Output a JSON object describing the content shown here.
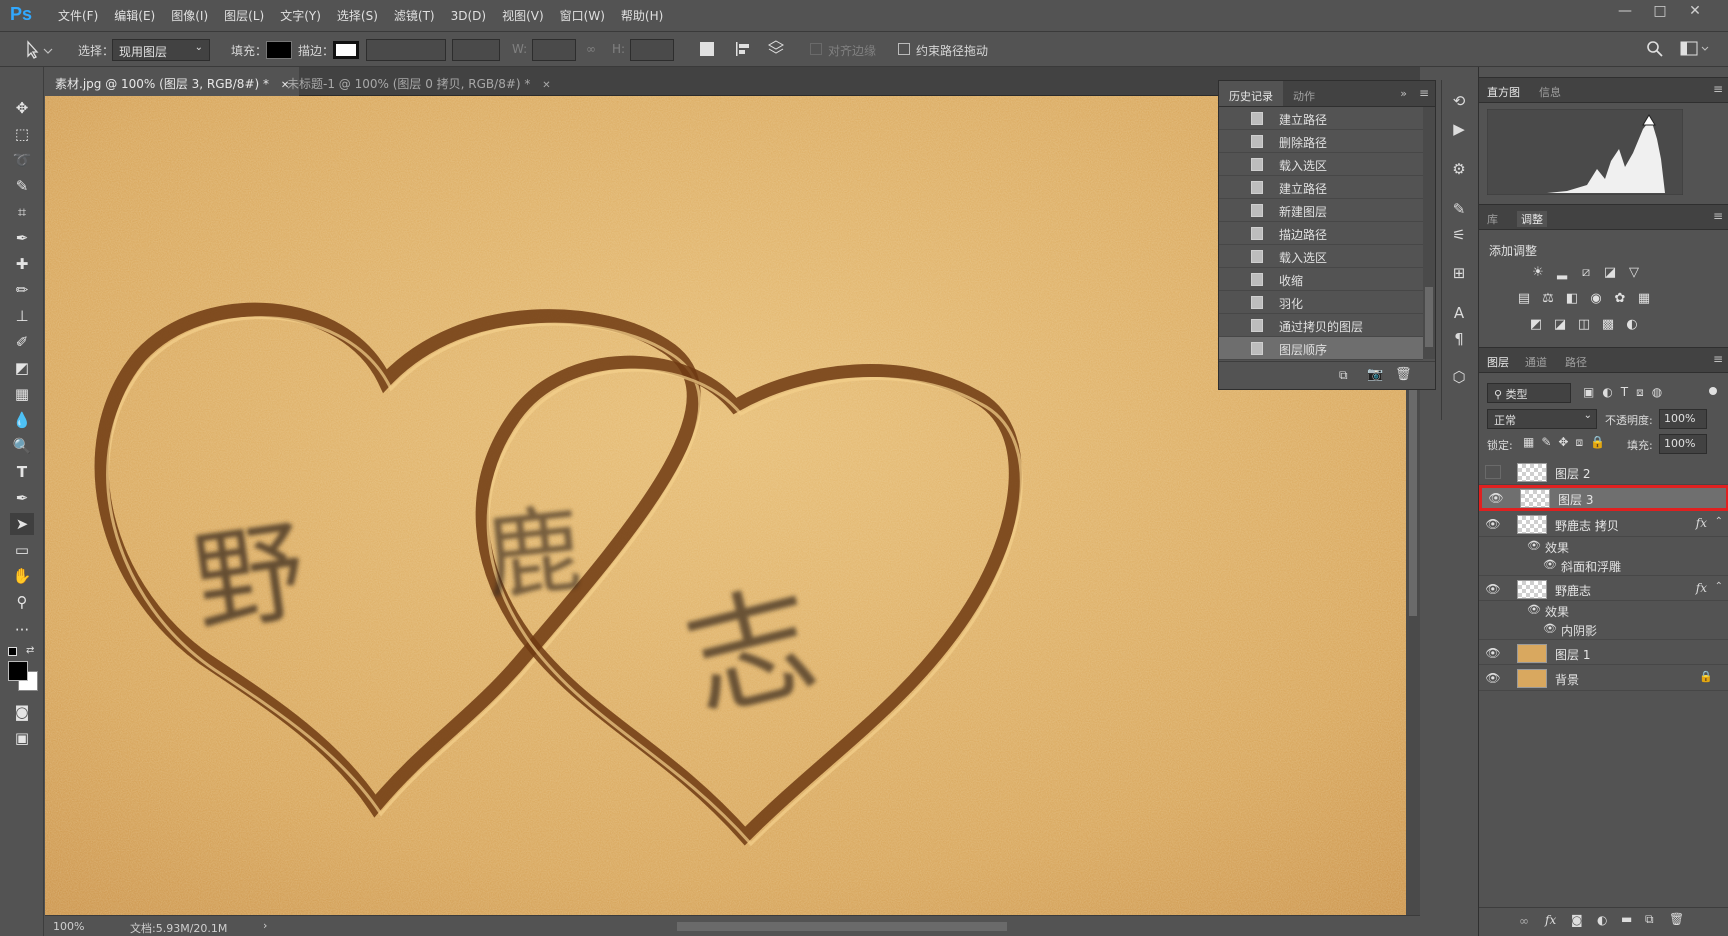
{
  "app": {
    "logo": "Ps"
  },
  "menu": [
    "文件(F)",
    "编辑(E)",
    "图像(I)",
    "图层(L)",
    "文字(Y)",
    "选择(S)",
    "滤镜(T)",
    "3D(D)",
    "视图(V)",
    "窗口(W)",
    "帮助(H)"
  ],
  "window_controls": {
    "minimize": "—",
    "maximize": "□",
    "close": "✕"
  },
  "options_bar": {
    "select_label": "选择：",
    "select_value": "现用图层",
    "fill_label": "填充：",
    "stroke_label": "描边：",
    "w_label": "W:",
    "h_label": "H:",
    "align_edges_label": "对齐边缘",
    "constrain_path_label": "约束路径拖动",
    "fill_color": "#000000"
  },
  "tabs": [
    {
      "label": "素材.jpg @ 100% (图层 3, RGB/8#) *",
      "close": "✕",
      "active": true
    },
    {
      "label": "未标题-1 @ 100% (图层 0 拷贝, RGB/8#) *",
      "close": "✕",
      "active": false
    }
  ],
  "canvas": {
    "chars": [
      "野",
      "鹿",
      "志"
    ]
  },
  "status": {
    "zoom": "100%",
    "doc_info": "文档:5.93M/20.1M",
    "arrow": "›"
  },
  "history_panel": {
    "tabs": [
      "历史记录",
      "动作"
    ],
    "items": [
      "建立路径",
      "删除路径",
      "载入选区",
      "建立路径",
      "新建图层",
      "描边路径",
      "载入选区",
      "收缩",
      "羽化",
      "通过拷贝的图层",
      "图层顺序"
    ],
    "selected_index": 10
  },
  "histogram_panel": {
    "tabs": [
      "直方图",
      "信息"
    ]
  },
  "adjust_panel": {
    "tabs": [
      "库",
      "调整"
    ],
    "title": "添加调整"
  },
  "layers_panel": {
    "tabs": [
      "图层",
      "通道",
      "路径"
    ],
    "filter_label": "类型",
    "blend_mode": "正常",
    "opacity_label": "不透明度:",
    "opacity_value": "100%",
    "lock_label": "锁定:",
    "fill_label": "填充:",
    "fill_value": "100%",
    "layers": [
      {
        "name": "图层 2",
        "visible": false
      },
      {
        "name": "图层 3",
        "visible": true,
        "selected": true
      },
      {
        "name": "野鹿志 拷贝",
        "visible": true,
        "fx": "fx",
        "effects_label": "效果",
        "effect": "斜面和浮雕"
      },
      {
        "name": "野鹿志",
        "visible": true,
        "fx": "fx",
        "effects_label": "效果",
        "effect": "内阴影"
      },
      {
        "name": "图层 1",
        "visible": true
      },
      {
        "name": "背景",
        "visible": true,
        "locked": true
      }
    ]
  },
  "colors": {
    "ui_bg": "#535353",
    "panel_dark": "#424242",
    "selection_red": "#e02020",
    "ps_blue": "#31a8ff",
    "sand": "#d7a35a"
  }
}
